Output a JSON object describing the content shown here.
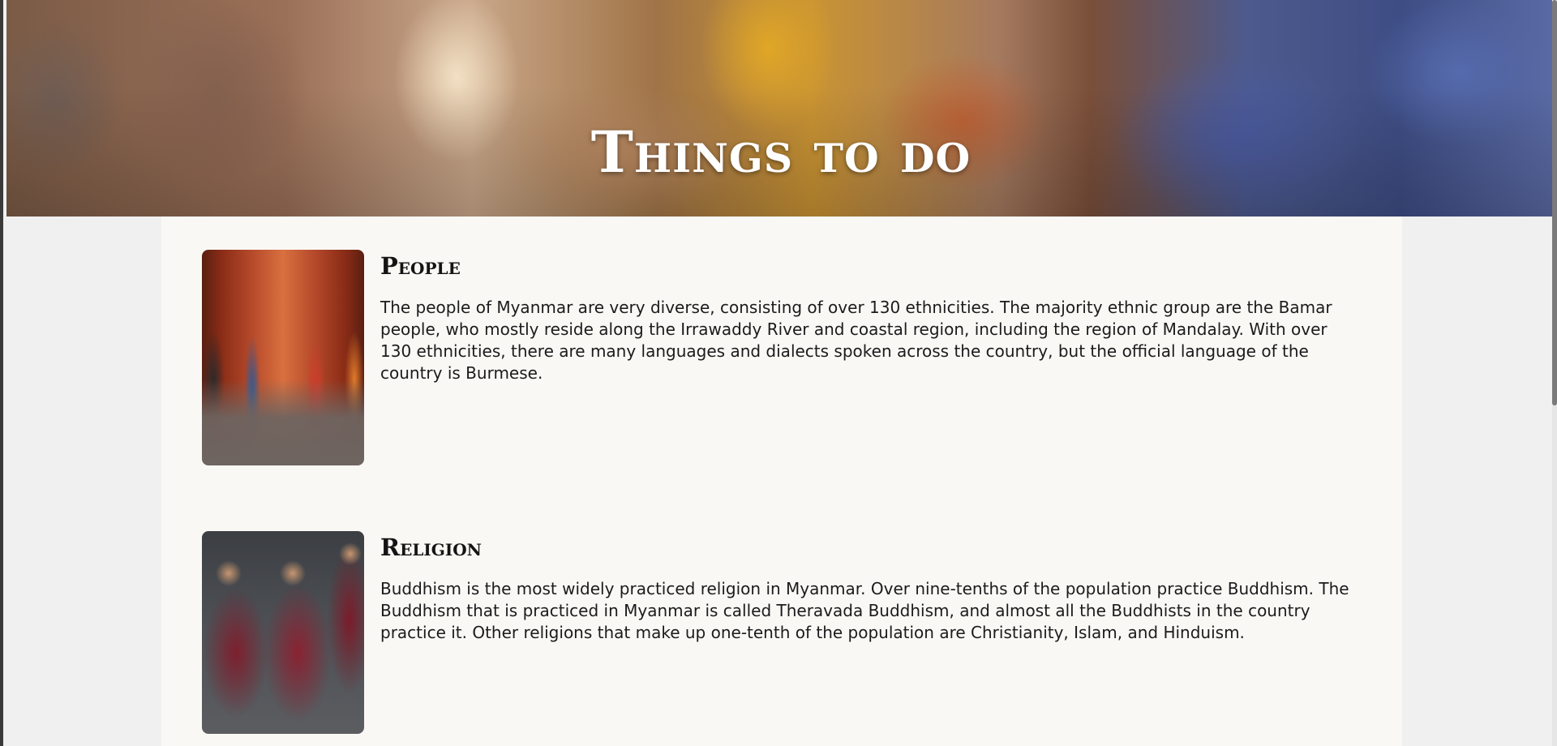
{
  "hero": {
    "title": "Things to do"
  },
  "sections": [
    {
      "heading": "People",
      "body": "The people of Myanmar are very diverse, consisting of over 130 ethnicities. The majority ethnic group are the Bamar people, who mostly reside along the Irrawaddy River and coastal region, including the region of Mandalay. With over 130 ethnicities, there are many languages and dialects spoken across the country, but the official language of the country is Burmese.",
      "image_icon": "people-photo-icon"
    },
    {
      "heading": "Religion",
      "body": "Buddhism is the most widely practiced religion in Myanmar. Over nine-tenths of the population practice Buddhism. The Buddhism that is practiced in Myanmar is called Theravada Buddhism, and almost all the Buddhists in the country practice it. Other religions that make up one-tenth of the population are Christianity, Islam, and Hinduism.",
      "image_icon": "monks-photo-icon"
    }
  ],
  "colors": {
    "page_background": "#f0f0f0",
    "content_background": "#faf8f5",
    "heading_text": "#141414",
    "body_text": "#1b1b1b",
    "hero_title_text": "#ffffff"
  }
}
